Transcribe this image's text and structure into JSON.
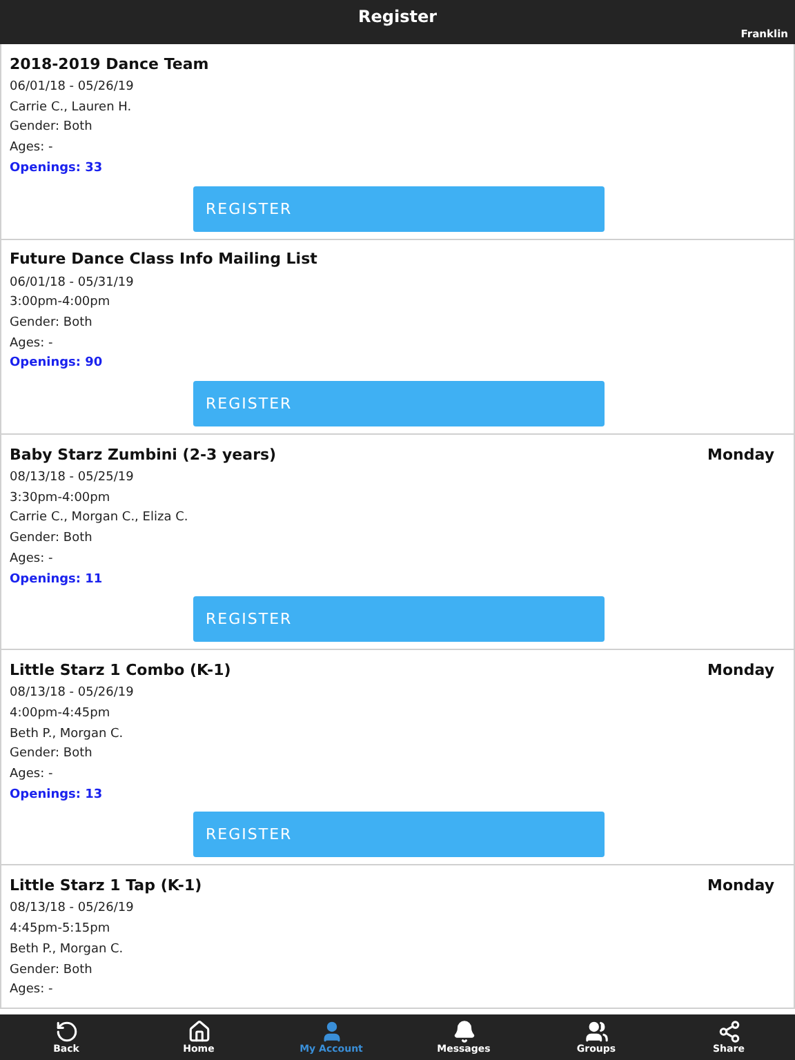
{
  "header": {
    "title": "Register",
    "location": "Franklin"
  },
  "classes": [
    {
      "title": "2018-2019 Dance Team",
      "lines": [
        "06/01/18 - 05/26/19",
        "Carrie C., Lauren H.",
        "Gender: Both",
        "Ages: -"
      ],
      "openings": "Openings: 33",
      "button": "REGISTER"
    },
    {
      "title": "Future Dance Class Info Mailing List",
      "lines": [
        "06/01/18 - 05/31/19",
        "3:00pm-4:00pm",
        "Gender: Both",
        "Ages: -"
      ],
      "openings": "Openings: 90",
      "button": "REGISTER"
    },
    {
      "title": "Baby Starz Zumbini (2-3 years)",
      "day": "Monday",
      "lines": [
        "08/13/18 - 05/25/19",
        "3:30pm-4:00pm",
        "Carrie C., Morgan C., Eliza C.",
        "Gender: Both",
        "Ages: -"
      ],
      "openings": "Openings: 11",
      "button": "REGISTER"
    },
    {
      "title": "Little Starz 1 Combo (K-1)",
      "day": "Monday",
      "lines": [
        "08/13/18 - 05/26/19",
        "4:00pm-4:45pm",
        "Beth P., Morgan C.",
        "Gender: Both",
        "Ages: -"
      ],
      "openings": "Openings: 13",
      "button": "REGISTER"
    },
    {
      "title": "Little Starz 1 Tap (K-1)",
      "day": "Monday",
      "lines": [
        "08/13/18 - 05/26/19",
        "4:45pm-5:15pm",
        "Beth P., Morgan C.",
        "Gender: Both",
        "Ages: -"
      ]
    }
  ],
  "tabs": [
    {
      "label": "Back",
      "kind": "back",
      "selected": false
    },
    {
      "label": "Home",
      "kind": "home",
      "selected": false
    },
    {
      "label": "My Account",
      "kind": "account",
      "selected": true
    },
    {
      "label": "Messages",
      "kind": "messages",
      "selected": false
    },
    {
      "label": "Groups",
      "kind": "groups",
      "selected": false
    },
    {
      "label": "Share",
      "kind": "share",
      "selected": false
    }
  ]
}
